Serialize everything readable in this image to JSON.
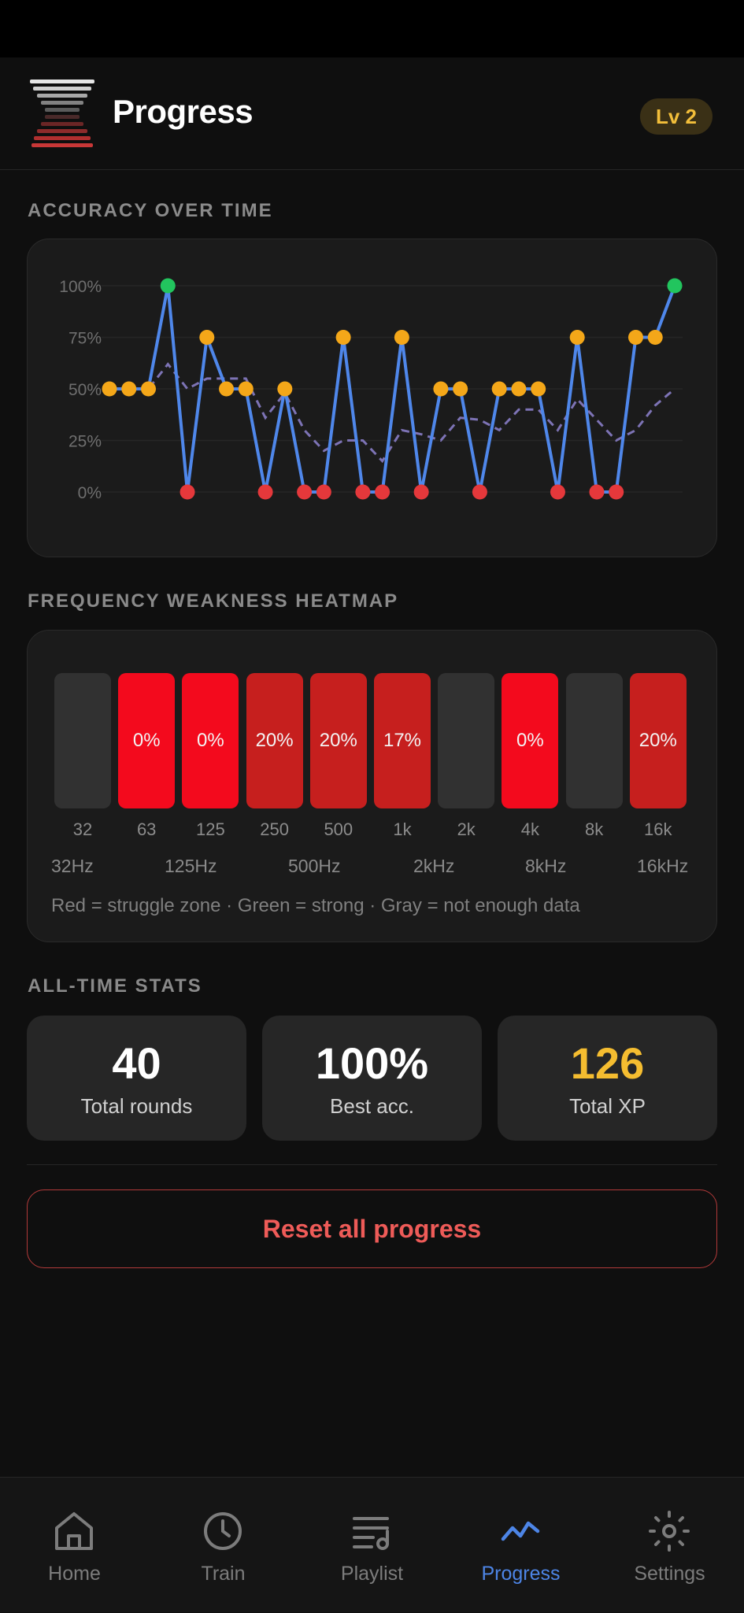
{
  "header": {
    "title": "Progress",
    "level_badge": "Lv 2"
  },
  "sections": {
    "accuracy_heading": "ACCURACY OVER TIME",
    "heatmap_heading": "FREQUENCY WEAKNESS HEATMAP",
    "stats_heading": "ALL-TIME STATS"
  },
  "chart_data": [
    {
      "type": "line",
      "x": [
        1,
        2,
        3,
        4,
        5,
        6,
        7,
        8,
        9,
        10,
        11,
        12,
        13,
        14,
        15,
        16,
        17,
        18,
        19,
        20,
        21,
        22,
        23,
        24,
        25,
        26,
        27,
        28,
        29,
        30,
        31
      ],
      "series": [
        {
          "values": [
            50,
            50,
            50,
            100,
            0,
            75,
            50,
            50,
            0,
            50,
            0,
            0,
            75,
            0,
            0,
            75,
            0,
            50,
            50,
            0,
            50,
            50,
            50,
            0,
            75,
            0,
            0,
            75,
            75,
            100
          ]
        },
        {
          "values": [
            50,
            50,
            50,
            62,
            50,
            55,
            55,
            55,
            36,
            48,
            30,
            20,
            25,
            25,
            15,
            30,
            28,
            25,
            36,
            35,
            30,
            40,
            40,
            30,
            45,
            35,
            25,
            30,
            42,
            50
          ]
        }
      ],
      "ylim": [
        0,
        100
      ],
      "yticks": [
        "0%",
        "25%",
        "50%",
        "75%",
        "100%"
      ],
      "point_colors": {
        "low": "#e5383b",
        "mid": "#f4a719",
        "high": "#22c55e"
      },
      "line_color": "#4f87ea",
      "trend_color": "#7d73b5"
    },
    {
      "type": "heatmap",
      "categories": [
        "32",
        "63",
        "125",
        "250",
        "500",
        "1k",
        "2k",
        "4k",
        "8k",
        "16k"
      ],
      "values": [
        null,
        0,
        0,
        20,
        20,
        17,
        null,
        0,
        null,
        20
      ],
      "cell_labels": [
        "",
        "0%",
        "0%",
        "20%",
        "20%",
        "17%",
        "",
        "0%",
        "",
        "20%"
      ],
      "range_labels": [
        "32Hz",
        "125Hz",
        "500Hz",
        "2kHz",
        "8kHz",
        "16kHz"
      ],
      "legend": "Red = struggle zone · Green = strong · Gray = not enough data",
      "colors": {
        "no_data": "#333333",
        "struggle": "#ff0a1e",
        "weak": "#d0201f"
      }
    }
  ],
  "stats": [
    {
      "value": "40",
      "label": "Total rounds",
      "color": "#ffffff"
    },
    {
      "value": "100%",
      "label": "Best acc.",
      "color": "#ffffff"
    },
    {
      "value": "126",
      "label": "Total XP",
      "color": "#f5bd30"
    }
  ],
  "actions": {
    "reset_label": "Reset all progress"
  },
  "nav": [
    {
      "label": "Home",
      "icon": "home-icon"
    },
    {
      "label": "Train",
      "icon": "clock-icon"
    },
    {
      "label": "Playlist",
      "icon": "playlist-icon"
    },
    {
      "label": "Progress",
      "icon": "trend-icon",
      "active": true
    },
    {
      "label": "Settings",
      "icon": "gear-icon"
    }
  ],
  "colors": {
    "accent": "#4d85e6",
    "badge_text": "#f2be3a",
    "danger": "#ee5b58"
  }
}
